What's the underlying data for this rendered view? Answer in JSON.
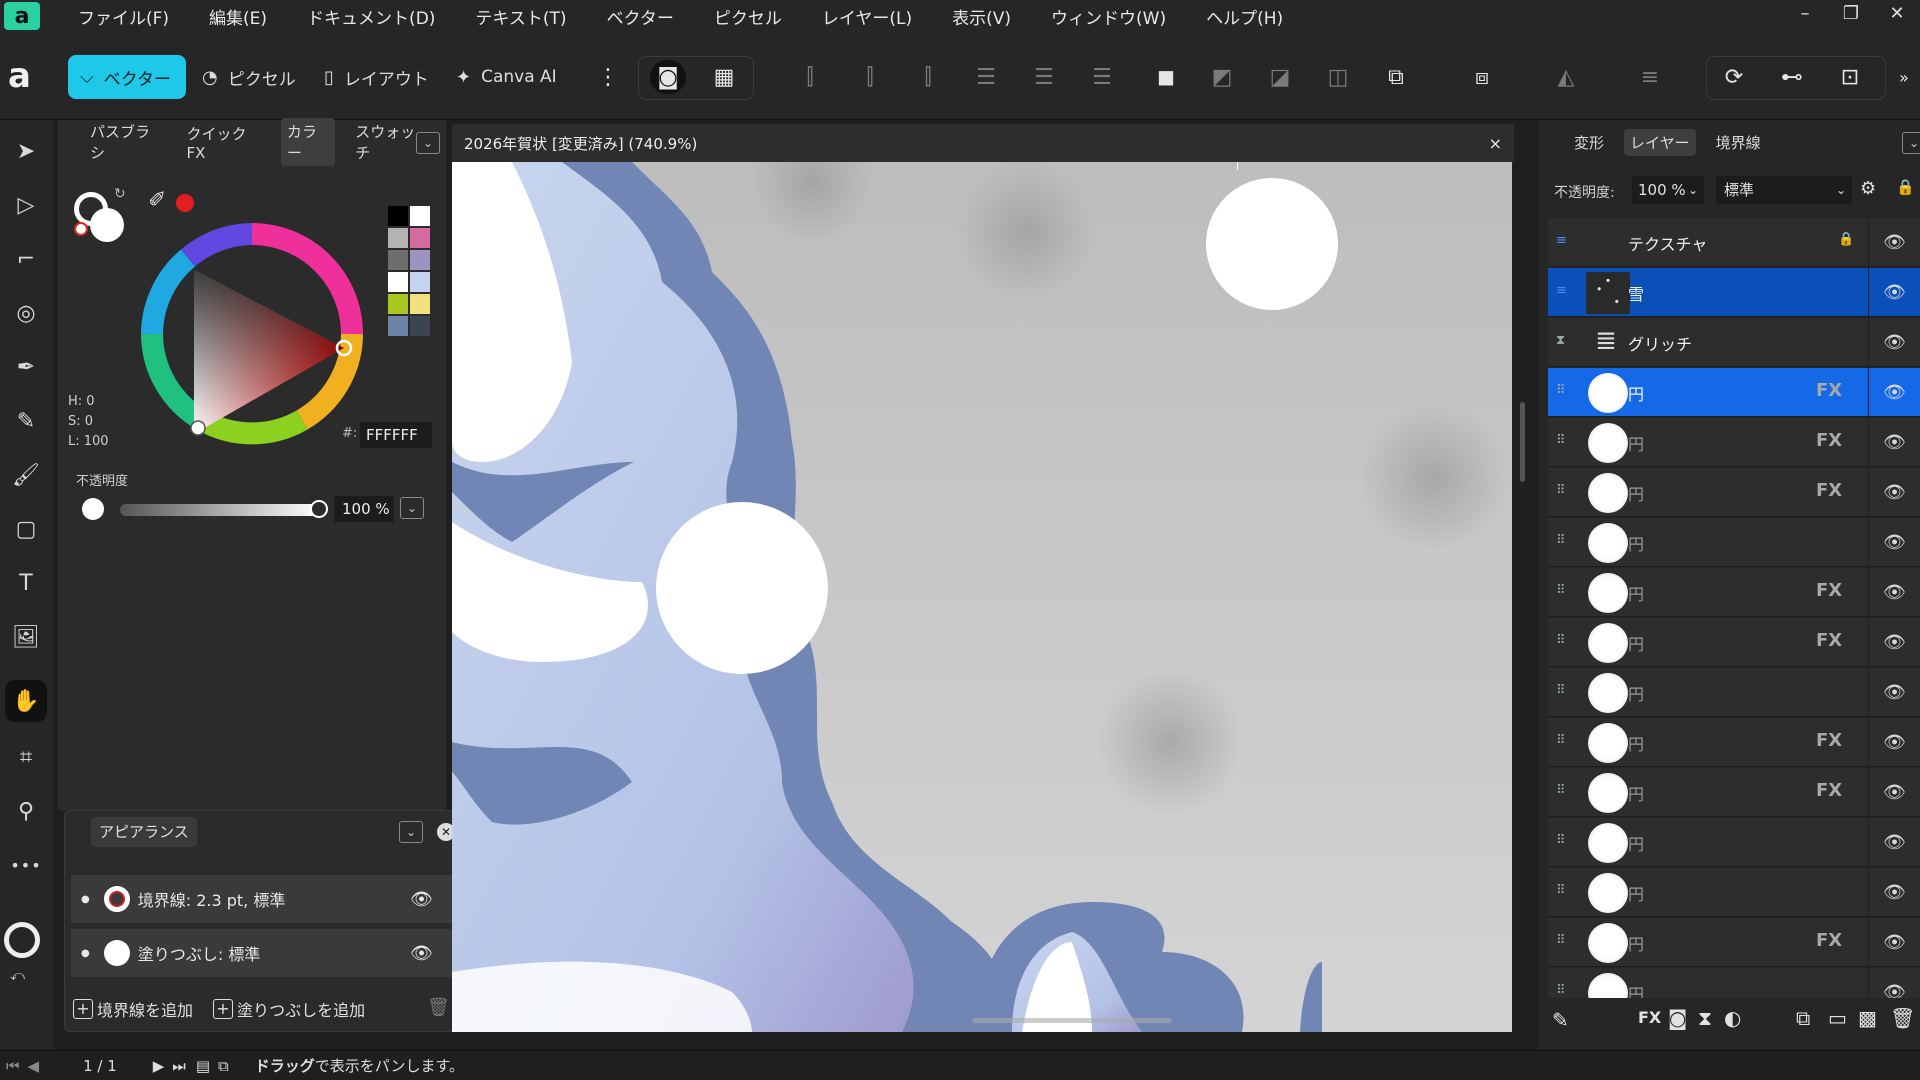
{
  "menu": {
    "items": [
      "ファイル(F)",
      "編集(E)",
      "ドキュメント(D)",
      "テキスト(T)",
      "ベクター",
      "ピクセル",
      "レイヤー(L)",
      "表示(V)",
      "ウィンドウ(W)",
      "ヘルプ(H)"
    ]
  },
  "personas": {
    "vector": "ベクター",
    "pixel": "ピクセル",
    "layout": "レイアウト",
    "canva_ai": "Canva AI"
  },
  "color_panel": {
    "tabs": [
      "パスブラシ",
      "クイックFX",
      "カラー",
      "スウォッチ"
    ],
    "selected_tab": "カラー",
    "h": "H: 0",
    "s": "S: 0",
    "l": "L: 100",
    "hex_label": "#:",
    "hex_value": "FFFFFF",
    "opacity_label": "不透明度",
    "opacity_value": "100 %",
    "swatches": [
      "#000000",
      "#ffffff",
      "#b3b3b3",
      "#d46aa0",
      "#6e6e6e",
      "#9b94c2",
      "#ffffff",
      "#c4d4f0",
      "#a8c820",
      "#f0e080",
      "#6d84a8",
      "#3a4450"
    ]
  },
  "appearance": {
    "title": "アピアランス",
    "stroke": "境界線: 2.3 pt,  標準",
    "fill": "塗りつぶし:  標準",
    "add_stroke": "境界線を追加",
    "add_fill": "塗りつぶしを追加"
  },
  "document": {
    "title": "2026年賀状 [変更済み] (740.9%)",
    "close": "×"
  },
  "right_panel": {
    "tabs": [
      "変形",
      "レイヤー",
      "境界線"
    ],
    "selected_tab": "レイヤー",
    "opacity_label": "不透明度:",
    "opacity_value": "100 %",
    "blend_mode": "標準"
  },
  "layers": [
    {
      "name": "テクスチャ",
      "kind": "group",
      "fx": false,
      "locked": true
    },
    {
      "name": "雪",
      "kind": "snow",
      "fx": false,
      "selected": "dark"
    },
    {
      "name": "グリッチ",
      "kind": "glitch",
      "fx": false
    },
    {
      "name": "円",
      "kind": "circle",
      "fx": true,
      "selected": "bright"
    },
    {
      "name": "円",
      "kind": "circle",
      "fx": true
    },
    {
      "name": "円",
      "kind": "circle",
      "fx": true
    },
    {
      "name": "円",
      "kind": "circle",
      "fx": false
    },
    {
      "name": "円",
      "kind": "circle",
      "fx": true
    },
    {
      "name": "円",
      "kind": "circle",
      "fx": true
    },
    {
      "name": "円",
      "kind": "circle",
      "fx": false
    },
    {
      "name": "円",
      "kind": "circle",
      "fx": true
    },
    {
      "name": "円",
      "kind": "circle",
      "fx": true
    },
    {
      "name": "円",
      "kind": "circle",
      "fx": false
    },
    {
      "name": "円",
      "kind": "circle",
      "fx": false
    },
    {
      "name": "円",
      "kind": "circle",
      "fx": true
    },
    {
      "name": "円",
      "kind": "circle",
      "fx": false
    }
  ],
  "fx_label": "FX",
  "status": {
    "page": "1 / 1",
    "hint_bold": "ドラッグ",
    "hint_rest": "で表示をパンします。"
  }
}
